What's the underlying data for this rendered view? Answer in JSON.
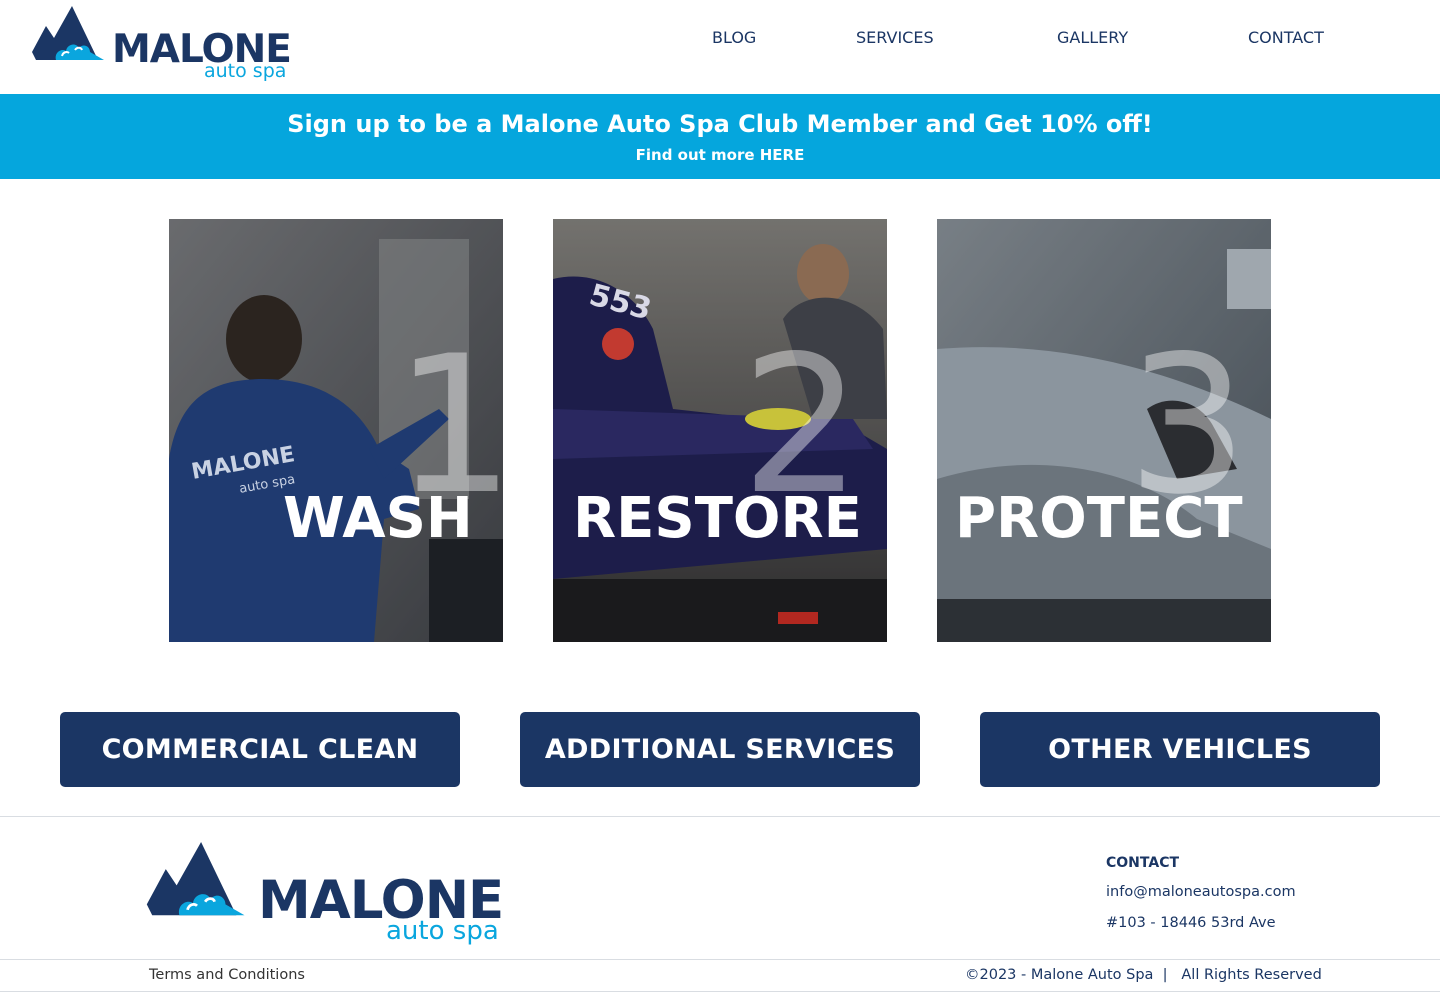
{
  "brand": {
    "name": "MALONE",
    "tagline": "auto spa"
  },
  "nav": {
    "items": [
      {
        "label": "BLOG"
      },
      {
        "label": "SERVICES"
      },
      {
        "label": "GALLERY"
      },
      {
        "label": "CONTACT"
      }
    ]
  },
  "promo": {
    "headline": "Sign up to be a Malone Auto Spa Club Member and Get 10% off!",
    "link": "Find out more HERE"
  },
  "steps": [
    {
      "number": "1",
      "label": "WASH",
      "shirt_word": "MALONE",
      "shirt_sub": "auto spa"
    },
    {
      "number": "2",
      "label": "RESTORE",
      "boat_number": "553"
    },
    {
      "number": "3",
      "label": "PROTECT"
    }
  ],
  "buttons": [
    {
      "label": "COMMERCIAL CLEAN"
    },
    {
      "label": "ADDITIONAL SERVICES"
    },
    {
      "label": "OTHER VEHICLES"
    }
  ],
  "footer": {
    "contact_heading": "CONTACT",
    "email": "info@maloneautospa.com",
    "address": "#103 - 18446 53rd Ave",
    "terms": "Terms and Conditions",
    "copyright": "©2023 - Malone Auto Spa  |   All Rights Reserved"
  },
  "colors": {
    "navy": "#1b3664",
    "brand_blue": "#05a6dd",
    "white": "#ffffff"
  },
  "icons": [
    "mountain-logo-icon"
  ]
}
